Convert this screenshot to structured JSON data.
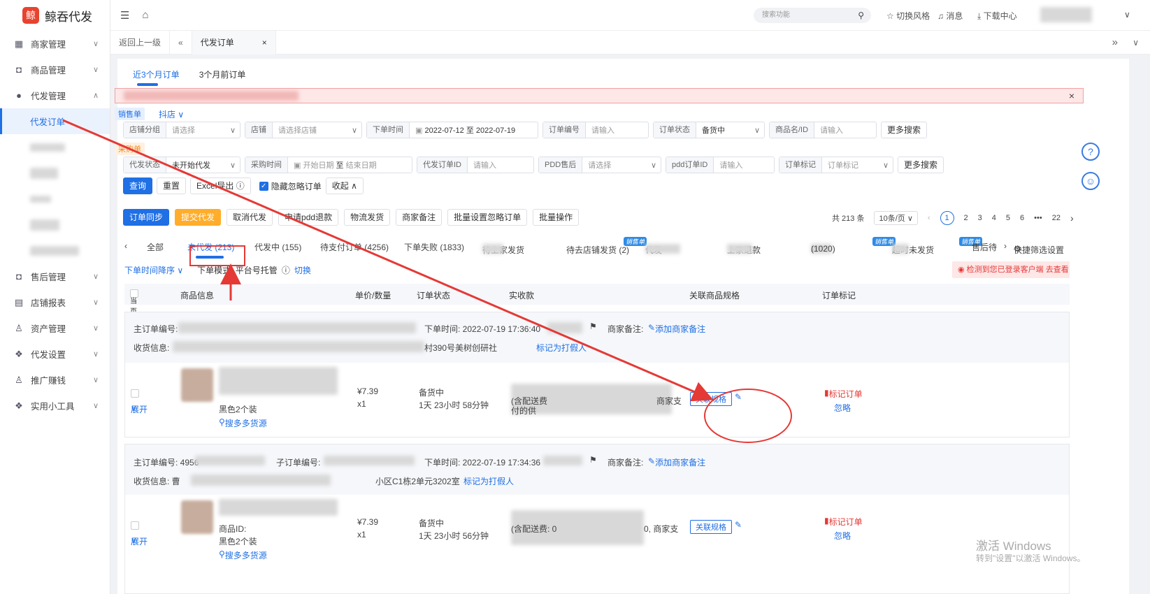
{
  "app": {
    "name": "鲸吞代发",
    "logo_char": "鲸"
  },
  "sidebar": {
    "items": [
      {
        "label": "商家管理",
        "icon": "store-icon"
      },
      {
        "label": "商品管理",
        "icon": "bag-icon"
      },
      {
        "label": "代发管理",
        "icon": "dispatch-icon"
      },
      {
        "label": "代发订单",
        "icon": ""
      },
      {
        "label": "售后管理",
        "icon": "aftersale-icon"
      },
      {
        "label": "店铺报表",
        "icon": "report-icon"
      },
      {
        "label": "资产管理",
        "icon": "user-icon"
      },
      {
        "label": "代发设置",
        "icon": "settings-icon"
      },
      {
        "label": "推广赚钱",
        "icon": "promote-icon"
      },
      {
        "label": "实用小工具",
        "icon": "tool-icon"
      }
    ]
  },
  "header": {
    "search_placeholder": "搜索功能",
    "switch_style": "切换风格",
    "messages": "消息",
    "download": "下载中心"
  },
  "tabs": {
    "back": "返回上一级",
    "current": "代发订单",
    "close": "×"
  },
  "subtabs": [
    "近3个月订单",
    "3个月前订单"
  ],
  "filters": {
    "sales_chip": "销售单",
    "platform": "抖店",
    "shop_group": {
      "label": "店铺分组",
      "value": "请选择"
    },
    "shop": {
      "label": "店铺",
      "value": "请选择店铺"
    },
    "order_time": {
      "label": "下单时间",
      "start": "2022-07-12",
      "to": "至",
      "end": "2022-07-19"
    },
    "order_no": {
      "label": "订单编号",
      "value": "请输入"
    },
    "order_status": {
      "label": "订单状态",
      "value": "备货中"
    },
    "product": {
      "label": "商品名/ID",
      "value": "请输入"
    },
    "more": "更多搜索",
    "purchase_chip": "采购单",
    "dispatch_status": {
      "label": "代发状态",
      "value": "未开始代发"
    },
    "purchase_time": {
      "label": "采购时间",
      "start": "开始日期",
      "to": "至",
      "end": "结束日期"
    },
    "dispatch_id": {
      "label": "代发订单ID",
      "value": "请输入"
    },
    "pdd_after": {
      "label": "PDD售后",
      "value": "请选择"
    },
    "pdd_order": {
      "label": "pdd订单ID",
      "value": "请输入"
    },
    "order_mark": {
      "label": "订单标记",
      "value": "订单标记"
    },
    "query": "查询",
    "reset": "重置",
    "excel": "Excel导出",
    "hide_ignored": "隐藏忽略订单",
    "collapse": "收起"
  },
  "actions": [
    "订单同步",
    "提交代发",
    "取消代发",
    "申请pdd退款",
    "物流发货",
    "商家备注",
    "批量设置忽略订单",
    "批量操作"
  ],
  "pager": {
    "total": "共 213 条",
    "size": "10条/页",
    "pages": [
      "1",
      "2",
      "3",
      "4",
      "5",
      "6",
      "•••",
      "22"
    ]
  },
  "order_tabs": [
    "全部",
    "未代发 (213)",
    "代发中 (155)",
    "待支付订单 (4256)",
    "下单失败 (1833)",
    "待上家发货",
    "待去店铺发货 (2)",
    "代发",
    "上家退款",
    "24h",
    "(1020)",
    "超时未发货",
    "售后待",
    "快捷筛选设置"
  ],
  "sort": {
    "label": "下单时间降序",
    "mode": "下单模式: 平台号托管",
    "switch": "切换"
  },
  "warning": "检测到您已登录客户端 去查看",
  "table_head": [
    "当页全选",
    "商品信息",
    "单价/数量",
    "订单状态",
    "实收款",
    "关联商品规格",
    "订单标记"
  ],
  "orders": [
    {
      "main_no": "主订单编号:",
      "sub_no": "",
      "time": "下单时间: 2022-07-19 17:36:40",
      "remark": "商家备注:",
      "add_remark": "添加商家备注",
      "addr": "收货信息:",
      "addr_tail": "村390号美树创研社",
      "fake": "标记为打假人",
      "expand": "展开",
      "spec_text": "黑色2个装",
      "find": "搜多多货源",
      "price": "¥7.39",
      "qty": "x1",
      "status": "备货中",
      "remain": "1天 23小时 58分钟",
      "link_spec": "关联规格",
      "mark": "标记订单",
      "ignore": "忽略",
      "pay_line1": "(含配送费",
      "pay_line2": "付的供",
      "pay_tail": "商家支"
    },
    {
      "main_no": "主订单编号: 4956",
      "sub_no": "子订单编号:",
      "time": "下单时间: 2022-07-19 17:34:36",
      "remark": "商家备注:",
      "add_remark": "添加商家备注",
      "addr": "收货信息: 曹",
      "addr_tail": "小区C1栋2单元3202室",
      "fake": "标记为打假人",
      "expand": "展开",
      "spec_text": "黑色2个装",
      "find": "搜多多货源",
      "product_id": "商品ID:",
      "price": "¥7.39",
      "qty": "x1",
      "status": "备货中",
      "remain": "1天 23小时 56分钟",
      "link_spec": "关联规格",
      "mark": "标记订单",
      "ignore": "忽略",
      "pay_line1": "(含配送费: 0",
      "pay_line2": "",
      "pay_tail": "0, 商家支"
    }
  ],
  "watermark": {
    "title": "激活 Windows",
    "sub": "转到\"设置\"以激活 Windows。"
  },
  "colors": {
    "primary": "#1f6fe5",
    "annotation": "#e53935",
    "warning_btn": "#ffad2a"
  }
}
